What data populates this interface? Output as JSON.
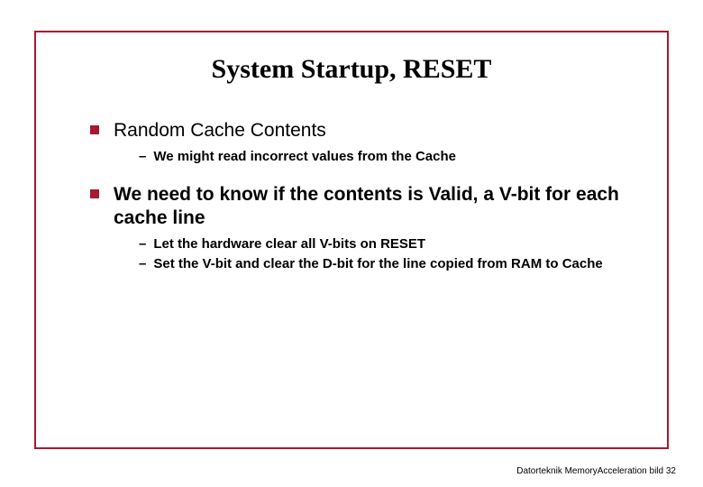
{
  "title": "System Startup, RESET",
  "bullets": [
    {
      "text": "Random Cache Contents",
      "subs": [
        "We might read incorrect values from the Cache"
      ]
    },
    {
      "text": "We need to know if the contents is Valid, a V-bit for each cache line",
      "subs": [
        "Let the hardware clear all V-bits on RESET",
        "Set the V-bit and clear the D-bit for the line copied from RAM to Cache"
      ]
    }
  ],
  "footer": "Datorteknik MemoryAcceleration bild 32"
}
